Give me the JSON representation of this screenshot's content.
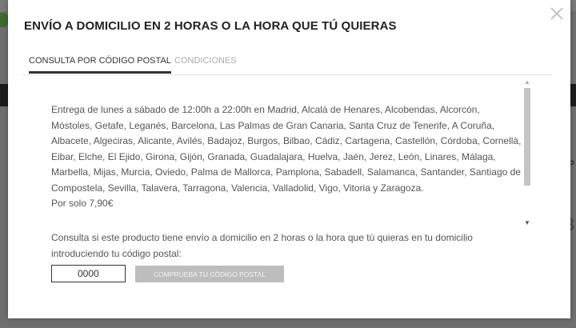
{
  "background": {
    "right_char_1": "P",
    "right_char_2": "3"
  },
  "modal": {
    "title": "ENVÍO A DOMICILIO EN 2 HORAS O LA HORA QUE TÚ QUIERAS",
    "tabs": [
      {
        "label": "CONSULTA POR CÓDIGO POSTAL",
        "active": true
      },
      {
        "label": "CONDICIONES",
        "active": false
      }
    ],
    "description": "Entrega de lunes a sábado de 12:00h a 22:00h en Madrid, Alcalá de Henares, Alcobendas, Alcorcón, Móstoles, Getafe, Leganés, Barcelona, Las Palmas de Gran Canaria, Santa Cruz de Tenerife, A Coruña, Albacete, Algeciras, Alicante, Avilés, Badajoz, Burgos, Bilbao, Cádiz, Cartagena, Castellón, Córdoba, Cornellà, Eibar, Elche, El Ejido, Girona, Gijón, Granada, Guadalajara, Huelva, Jaén, Jerez, León, Linares, Málaga, Marbella, Mijas, Murcia, Oviedo, Palma de Mallorca, Pamplona, Sabadell, Salamanca, Santander, Santiago de Compostela, Sevilla, Talavera, Tarragona, Valencia, Valladolid, Vigo, Vitoria y Zaragoza.",
    "price": "Por solo 7,90€",
    "consult_text": "Consulta si este producto tiene envío a domicilio en 2 horas o la hora que tú quieras en tu domicilio introduciendo tu código postal:",
    "postal_value": "0000",
    "check_button": "COMPRUEBA TU CÓDIGO POSTAL",
    "scrollbar_position": 0.0
  }
}
